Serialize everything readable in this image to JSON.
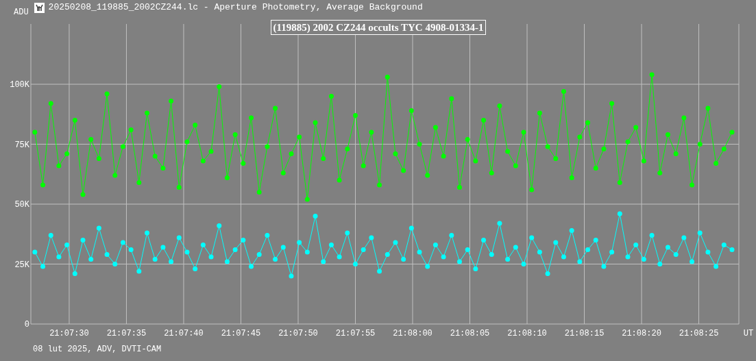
{
  "window": {
    "title": "20250208_119885_2002CZ244.lc - Aperture Photometry, Average Background"
  },
  "chart": {
    "chart_data": {
      "type": "line",
      "grid": true,
      "title": "(119885) 2002 CZ244 occults TYC 4908-01334-1",
      "xlabel": "UT",
      "ylabel": "ADU",
      "xlim": [
        76046.65,
        76108.5
      ],
      "ylim": [
        0,
        125
      ],
      "yticks": [
        {
          "value": 100,
          "label": "100K"
        },
        {
          "value": 75,
          "label": "75K"
        },
        {
          "value": 50,
          "label": "50K"
        },
        {
          "value": 25,
          "label": "25K"
        },
        {
          "value": 0,
          "label": "0"
        }
      ],
      "xticks": [
        {
          "value": 76050,
          "label": "21:07:30"
        },
        {
          "value": 76055,
          "label": "21:07:35"
        },
        {
          "value": 76060,
          "label": "21:07:40"
        },
        {
          "value": 76065,
          "label": "21:07:45"
        },
        {
          "value": 76070,
          "label": "21:07:50"
        },
        {
          "value": 76075,
          "label": "21:07:55"
        },
        {
          "value": 76080,
          "label": "21:08:00"
        },
        {
          "value": 76085,
          "label": "21:08:05"
        },
        {
          "value": 76090,
          "label": "21:08:10"
        },
        {
          "value": 76095,
          "label": "21:08:15"
        },
        {
          "value": 76100,
          "label": "21:08:20"
        },
        {
          "value": 76105,
          "label": "21:08:25"
        }
      ],
      "x": [
        76047.0,
        76047.7,
        76048.4,
        76049.1,
        76049.8,
        76050.5,
        76051.2,
        76051.9,
        76052.6,
        76053.3,
        76054.0,
        76054.7,
        76055.4,
        76056.1,
        76056.8,
        76057.5,
        76058.2,
        76058.9,
        76059.6,
        76060.3,
        76061.0,
        76061.7,
        76062.4,
        76063.1,
        76063.8,
        76064.5,
        76065.2,
        76065.9,
        76066.6,
        76067.3,
        76068.0,
        76068.7,
        76069.4,
        76070.1,
        76070.8,
        76071.5,
        76072.2,
        76072.9,
        76073.6,
        76074.3,
        76075.0,
        76075.7,
        76076.4,
        76077.1,
        76077.8,
        76078.5,
        76079.2,
        76079.9,
        76080.6,
        76081.3,
        76082.0,
        76082.7,
        76083.4,
        76084.1,
        76084.8,
        76085.5,
        76086.2,
        76086.9,
        76087.6,
        76088.3,
        76089.0,
        76089.7,
        76090.4,
        76091.1,
        76091.8,
        76092.5,
        76093.2,
        76093.9,
        76094.6,
        76095.3,
        76096.0,
        76096.7,
        76097.4,
        76098.1,
        76098.8,
        76099.5,
        76100.2,
        76100.9,
        76101.6,
        76102.3,
        76103.0,
        76103.7,
        76104.4,
        76105.1,
        76105.8,
        76106.5,
        76107.2,
        76107.9
      ],
      "series": [
        {
          "color": "#00ff00",
          "marker": "circle",
          "values": [
            80,
            58,
            92,
            66,
            71,
            85,
            54,
            77,
            69,
            96,
            62,
            74,
            81,
            59,
            88,
            70,
            65,
            93,
            57,
            76,
            83,
            68,
            72,
            99,
            61,
            79,
            67,
            86,
            55,
            74,
            90,
            63,
            71,
            78,
            52,
            84,
            69,
            95,
            60,
            73,
            87,
            66,
            80,
            58,
            103,
            71,
            64,
            89,
            75,
            62,
            82,
            70,
            94,
            57,
            77,
            68,
            85,
            63,
            91,
            72,
            66,
            80,
            56,
            88,
            74,
            69,
            97,
            61,
            78,
            84,
            65,
            73,
            92,
            59,
            76,
            82,
            68,
            104,
            63,
            79,
            71,
            86,
            58,
            75,
            90,
            67,
            73,
            80
          ]
        },
        {
          "color": "#00ffff",
          "marker": "circle",
          "values": [
            30,
            24,
            37,
            28,
            33,
            21,
            35,
            27,
            40,
            29,
            25,
            34,
            31,
            22,
            38,
            27,
            32,
            26,
            36,
            30,
            23,
            33,
            28,
            41,
            26,
            31,
            35,
            24,
            29,
            37,
            27,
            32,
            20,
            34,
            30,
            45,
            26,
            33,
            28,
            38,
            25,
            31,
            36,
            22,
            29,
            34,
            27,
            40,
            30,
            24,
            33,
            28,
            37,
            26,
            31,
            23,
            35,
            29,
            42,
            27,
            32,
            25,
            36,
            30,
            21,
            34,
            28,
            39,
            26,
            31,
            35,
            24,
            30,
            46,
            28,
            33,
            27,
            37,
            25,
            32,
            29,
            36,
            26,
            38,
            30,
            24,
            33,
            31
          ]
        }
      ]
    }
  },
  "footer": "08 lut 2025, ADV, DVTI-CAM"
}
